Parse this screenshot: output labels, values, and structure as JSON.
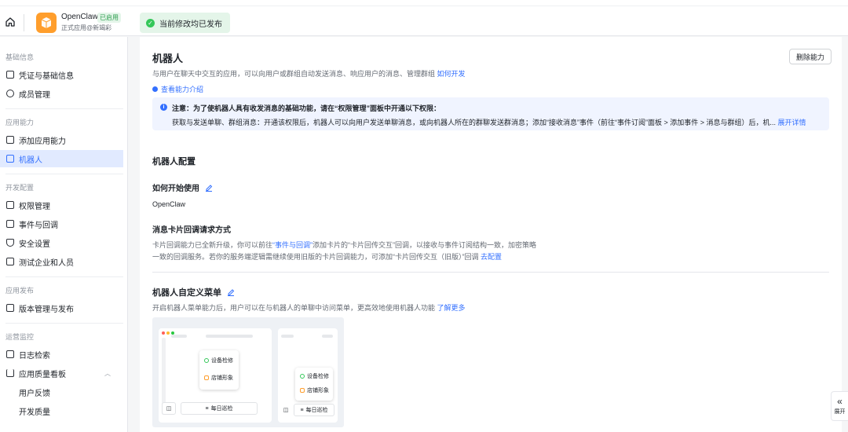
{
  "app": {
    "name": "OpenClaw",
    "tag": "已启用",
    "subtitle": "正式应用@新竭彩",
    "logo_color": "#ff9e2c"
  },
  "status": {
    "published": "当前修改均已发布"
  },
  "sidebar": {
    "groups": [
      {
        "label": "基础信息",
        "items": [
          {
            "label": "凭证与基础信息",
            "icon": "id-card-icon"
          },
          {
            "label": "成员管理",
            "icon": "user-icon"
          }
        ]
      },
      {
        "label": "应用能力",
        "items": [
          {
            "label": "添加应用能力",
            "icon": "grid-icon"
          },
          {
            "label": "机器人",
            "icon": "robot-icon",
            "active": true
          }
        ]
      },
      {
        "label": "开发配置",
        "items": [
          {
            "label": "权限管理",
            "icon": "lock-icon"
          },
          {
            "label": "事件与回调",
            "icon": "event-icon"
          },
          {
            "label": "安全设置",
            "icon": "shield-icon"
          },
          {
            "label": "测试企业和人员",
            "icon": "test-icon"
          }
        ]
      },
      {
        "label": "应用发布",
        "items": [
          {
            "label": "版本管理与发布",
            "icon": "upload-icon"
          }
        ]
      },
      {
        "label": "运营监控",
        "items": [
          {
            "label": "日志检索",
            "icon": "log-icon"
          },
          {
            "label": "应用质量看板",
            "icon": "chart-icon"
          },
          {
            "label": "用户反馈"
          },
          {
            "label": "开发质量"
          }
        ]
      }
    ]
  },
  "main": {
    "title": "机器人",
    "remove_button": "删除能力",
    "desc": "与用户在聊天中交互的应用，可以向用户或群组自动发送消息、响应用户的消息、管理群组",
    "desc_link": "如何开发",
    "intro_link": "查看能力介绍",
    "notice": {
      "line1": "注意：为了使机器人具有收发消息的基础功能，请在“权限管理”面板中开通以下权限：",
      "line2": "获取与发送单聊、群组消息：开通该权限后，机器人可以向用户发送单聊消息，或向机器人所在的群聊发送群消息；添加“接收消息”事件（前往“事件订阅”面板 > 添加事件 > 消息与群组）后，机...",
      "expand": "展开详情"
    },
    "config": {
      "heading": "机器人配置",
      "how_to_start": "如何开始使用",
      "how_to_value": "OpenClaw",
      "card_callback_title": "消息卡片回调请求方式",
      "card_callback_l1_a": "卡片回调能力已全新升级，你可以前往",
      "card_callback_l1_link": "“事件与回调”",
      "card_callback_l1_b": "添加卡片的“卡片回传交互”回调，以接收与事件订阅结构一致，加密策略",
      "card_callback_l2": "一致的回调服务。若你的服务端逻辑需继续使用旧版的卡片回调能力，可添加“卡片回传交互（旧版）”回调",
      "card_callback_l2_link": "去配置"
    },
    "menu": {
      "heading": "机器人自定义菜单",
      "desc": "开启机器人菜单能力后，用户可以在与机器人的单聊中访问菜单，更高效地使用机器人功能",
      "desc_link": "了解更多",
      "preview": {
        "item1": "设备检修",
        "item2": "店铺形象",
        "bottom": "每日巡检"
      }
    }
  },
  "expand_tab": "展开",
  "colors": {
    "accent": "#3370ff",
    "success": "#34c759",
    "active_bg": "#e1eaff"
  }
}
